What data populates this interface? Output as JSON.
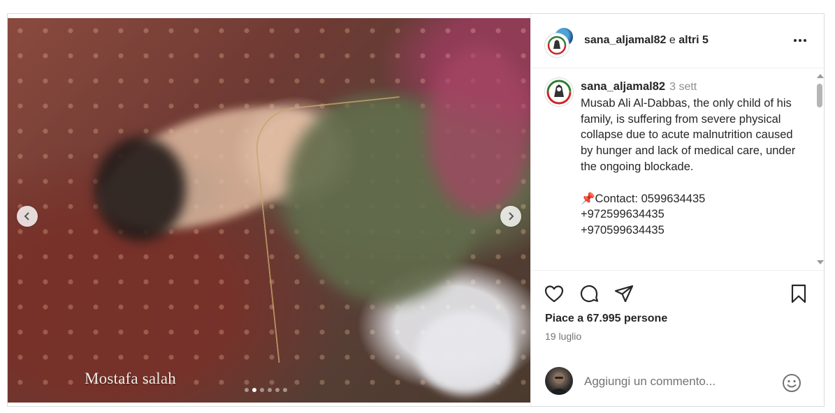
{
  "header": {
    "username": "sana_aljamal82",
    "separator": "e",
    "others": "altri 5"
  },
  "media": {
    "watermark": "Mostafa salah",
    "carousel": {
      "count": 6,
      "active_index": 1
    }
  },
  "caption": {
    "username": "sana_aljamal82",
    "time": "3 sett",
    "text": "Musab Ali Al-Dabbas, the only child of his family, is suffering from severe physical collapse due to acute malnutrition caused by hunger and lack of medical care, under the ongoing blockade.\n\n📌Contact: 0599634435\n+972599634435\n+970599634435"
  },
  "stats": {
    "likes": "Piace a 67.995 persone",
    "date": "19 luglio"
  },
  "comment": {
    "placeholder": "Aggiungi un commento..."
  },
  "icons": [
    "heart-icon",
    "comment-icon",
    "share-icon",
    "bookmark-icon",
    "more-options-icon",
    "emoji-icon",
    "chevron-left-icon",
    "chevron-right-icon"
  ]
}
